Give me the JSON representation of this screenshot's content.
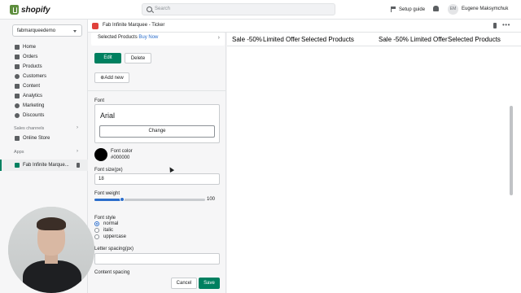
{
  "topbar": {
    "brand": "shopify",
    "search_placeholder": "Search",
    "setup_guide": "Setup guide",
    "user_initials": "EM",
    "user_name": "Eugene Maksymchuk"
  },
  "sidebar": {
    "store": "fabmarqueedemo",
    "items": [
      {
        "label": "Home"
      },
      {
        "label": "Orders"
      },
      {
        "label": "Products"
      },
      {
        "label": "Customers"
      },
      {
        "label": "Content"
      },
      {
        "label": "Analytics"
      },
      {
        "label": "Marketing"
      },
      {
        "label": "Discounts"
      }
    ],
    "sales_channels_label": "Sales channels",
    "online_store": "Online Store",
    "apps_label": "Apps",
    "app_item": "Fab Infinite Marque..."
  },
  "app_header": {
    "title": "Fab Infinite Marquee - Ticker"
  },
  "panel": {
    "selected_products": "Selected Products",
    "buy_now": "Buy Now",
    "edit": "Edit",
    "delete": "Delete",
    "add_new": "⊕Add new",
    "font_label": "Font",
    "font_name": "Arial",
    "change": "Change",
    "font_color_label": "Font color",
    "font_color_value": "#000000",
    "font_size_label": "Font size(px)",
    "font_size_value": "18",
    "font_weight_label": "Font weight",
    "font_weight_value": "100",
    "font_weight_fraction": 0.25,
    "font_style_label": "Font style",
    "font_styles": [
      {
        "label": "normal",
        "selected": true
      },
      {
        "label": "italic",
        "selected": false
      },
      {
        "label": "uppercase",
        "selected": false
      }
    ],
    "letter_spacing_label": "Letter spacing(px)",
    "content_spacing_label": "Content spacing",
    "cancel": "Cancel",
    "save": "Save"
  },
  "preview": {
    "ticker_items": [
      "Sale -50%",
      "Limited Offer",
      "Selected Products",
      "Sale -50%",
      "Limited Offer",
      "Selected Products"
    ]
  },
  "colors": {
    "accent_green": "#008060",
    "link_blue": "#2c6ecb",
    "brand_green": "#5e8e3e"
  }
}
